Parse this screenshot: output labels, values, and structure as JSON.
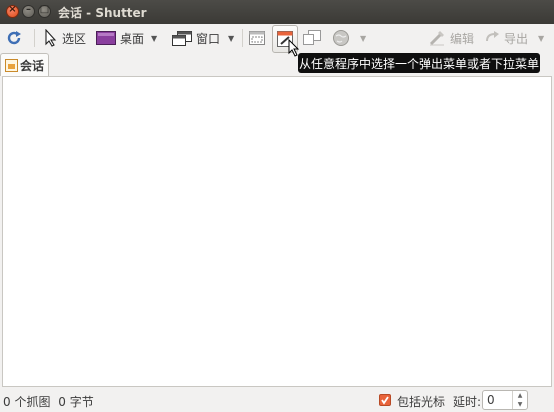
{
  "window": {
    "title": "会话 - Shutter",
    "close_glyph": "×",
    "min_glyph": "–",
    "max_glyph": "□"
  },
  "toolbar": {
    "selection_label": "选区",
    "desktop_label": "桌面",
    "window_label": "窗口",
    "edit_label": "编辑",
    "export_label": "导出",
    "dropdown_glyph": "▼"
  },
  "tabs": [
    {
      "label": "会话"
    }
  ],
  "tooltip": {
    "text": "从任意程序中选择一个弹出菜单或者下拉菜单"
  },
  "status": {
    "screenshots_count": "0 个抓图",
    "bytes_count": "0 字节",
    "include_cursor_label": "包括光标",
    "include_cursor_checked": true,
    "delay_label": "延时:",
    "delay_value": "0"
  },
  "colors": {
    "accent": "#e9643b",
    "titlebar": "#3c3b37",
    "tooltip_bg": "#0f0f0f"
  },
  "icons": {
    "refresh": "refresh-icon",
    "selection": "cursor-arrow-icon",
    "desktop": "desktop-icon",
    "window": "window-icon",
    "section": "section-icon",
    "menu": "menu-icon",
    "tooltip": "tooltip-icon",
    "web": "globe-icon",
    "edit": "edit-icon",
    "export": "export-icon"
  }
}
